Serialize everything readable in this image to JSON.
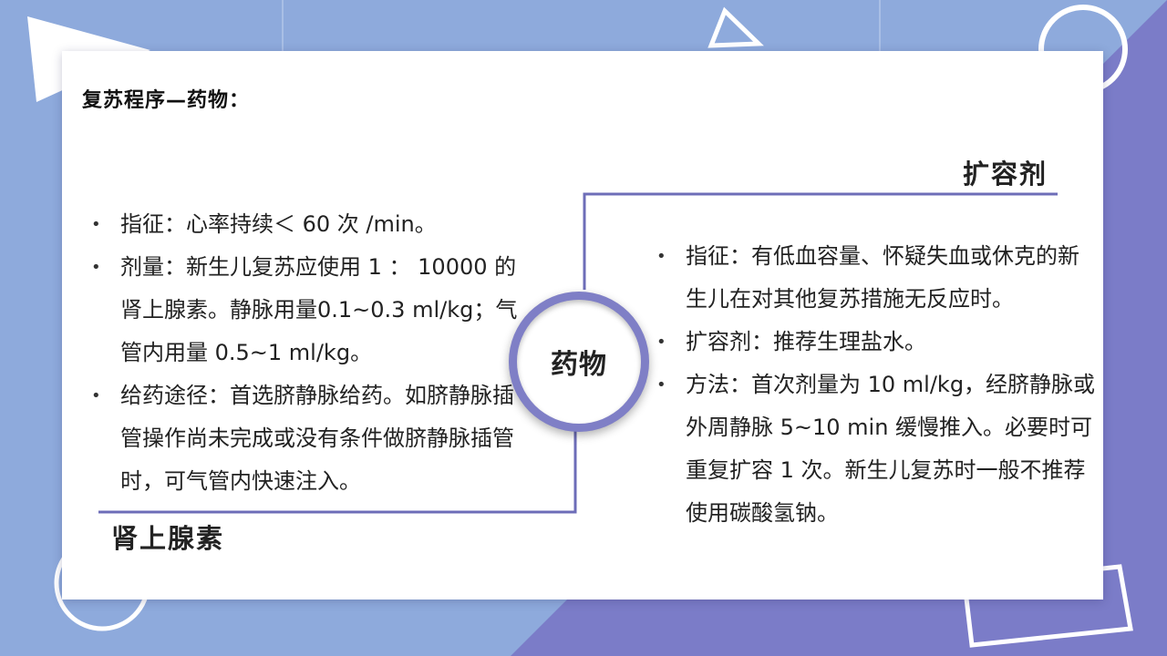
{
  "slide": {
    "title": "复苏程序—药物：",
    "center_label": "药物",
    "right_heading": "扩容剂",
    "left_heading": "肾上腺素",
    "left_bullets": [
      "指征：心率持续＜ 60 次 /min。",
      "剂量：新生儿复苏应使用 1 ： 10000 的肾上腺素。静脉用量0.1~0.3 ml/kg；气管内用量 0.5~1 ml/kg。",
      "给药途径：首选脐静脉给药。如脐静脉插管操作尚未完成或没有条件做脐静脉插管时，可气管内快速注入。"
    ],
    "right_bullets": [
      "指征：有低血容量、怀疑失血或休克的新生儿在对其他复苏措施无反应时。",
      "扩容剂：推荐生理盐水。",
      "方法：首次剂量为 10 ml/kg，经脐静脉或外周静脉 5~10 min 缓慢推入。必要时可重复扩容 1 次。新生儿复苏时一般不推荐使用碳酸氢钠。"
    ]
  },
  "colors": {
    "background_light": "#8eaadc",
    "background_purple": "#7b7cc8",
    "accent_line": "#6d6db8",
    "card": "#ffffff"
  }
}
